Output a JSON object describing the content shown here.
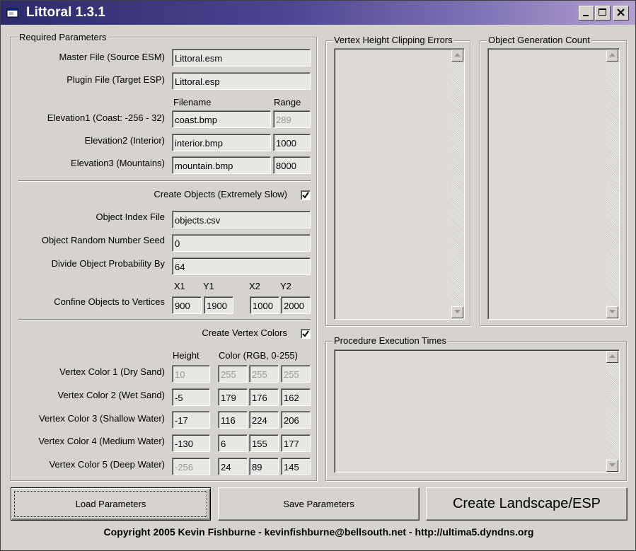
{
  "window": {
    "title": "Littoral 1.3.1",
    "icon": "app-window-icon",
    "controls": [
      "minimize-icon",
      "maximize-icon",
      "close-icon"
    ]
  },
  "required": {
    "legend": "Required Parameters",
    "master_label": "Master File (Source ESM)",
    "master_value": "Littoral.esm",
    "plugin_label": "Plugin File (Target ESP)",
    "plugin_value": "Littoral.esp",
    "filename_header": "Filename",
    "range_header": "Range",
    "elevations": [
      {
        "label": "Elevation1 (Coast: -256 - 32)",
        "file": "coast.bmp",
        "range": "289",
        "range_disabled": true
      },
      {
        "label": "Elevation2 (Interior)",
        "file": "interior.bmp",
        "range": "1000",
        "range_disabled": false
      },
      {
        "label": "Elevation3 (Mountains)",
        "file": "mountain.bmp",
        "range": "8000",
        "range_disabled": false
      }
    ],
    "create_objects_label": "Create Objects (Extremely Slow)",
    "create_objects_checked": true,
    "object_index_label": "Object Index File",
    "object_index_value": "objects.csv",
    "seed_label": "Object Random Number Seed",
    "seed_value": "0",
    "divide_label": "Divide Object Probability By",
    "divide_value": "64",
    "confine_label": "Confine Objects to Vertices",
    "x1_header": "X1",
    "y1_header": "Y1",
    "x2_header": "X2",
    "y2_header": "Y2",
    "x1": "900",
    "y1": "1900",
    "x2": "1000",
    "y2": "2000",
    "create_colors_label": "Create Vertex Colors",
    "create_colors_checked": true,
    "height_header": "Height",
    "color_header": "Color (RGB, 0-255)",
    "vertex_colors": [
      {
        "label": "Vertex Color 1 (Dry Sand)",
        "height": "10",
        "r": "255",
        "g": "255",
        "b": "255",
        "disabled": true
      },
      {
        "label": "Vertex Color 2 (Wet Sand)",
        "height": "-5",
        "r": "179",
        "g": "176",
        "b": "162",
        "disabled": false
      },
      {
        "label": "Vertex Color 3 (Shallow Water)",
        "height": "-17",
        "r": "116",
        "g": "224",
        "b": "206",
        "disabled": false
      },
      {
        "label": "Vertex Color 4 (Medium Water)",
        "height": "-130",
        "r": "6",
        "g": "155",
        "b": "177",
        "disabled": false
      },
      {
        "label": "Vertex Color 5 (Deep Water)",
        "height": "-256",
        "r": "24",
        "g": "89",
        "b": "145",
        "height_disabled": true
      }
    ]
  },
  "panels": {
    "clipping_legend": "Vertex Height Clipping Errors",
    "objgen_legend": "Object Generation Count",
    "times_legend": "Procedure Execution Times"
  },
  "buttons": {
    "load": "Load Parameters",
    "save": "Save Parameters",
    "create": "Create Landscape/ESP"
  },
  "footer": "Copyright 2005 Kevin Fishburne - kevinfishburne@bellsouth.net - http://ultima5.dyndns.org",
  "colors": {
    "title_start": "#2d2a6c",
    "title_end": "#b49fd0",
    "face": "#d6d3ce"
  }
}
